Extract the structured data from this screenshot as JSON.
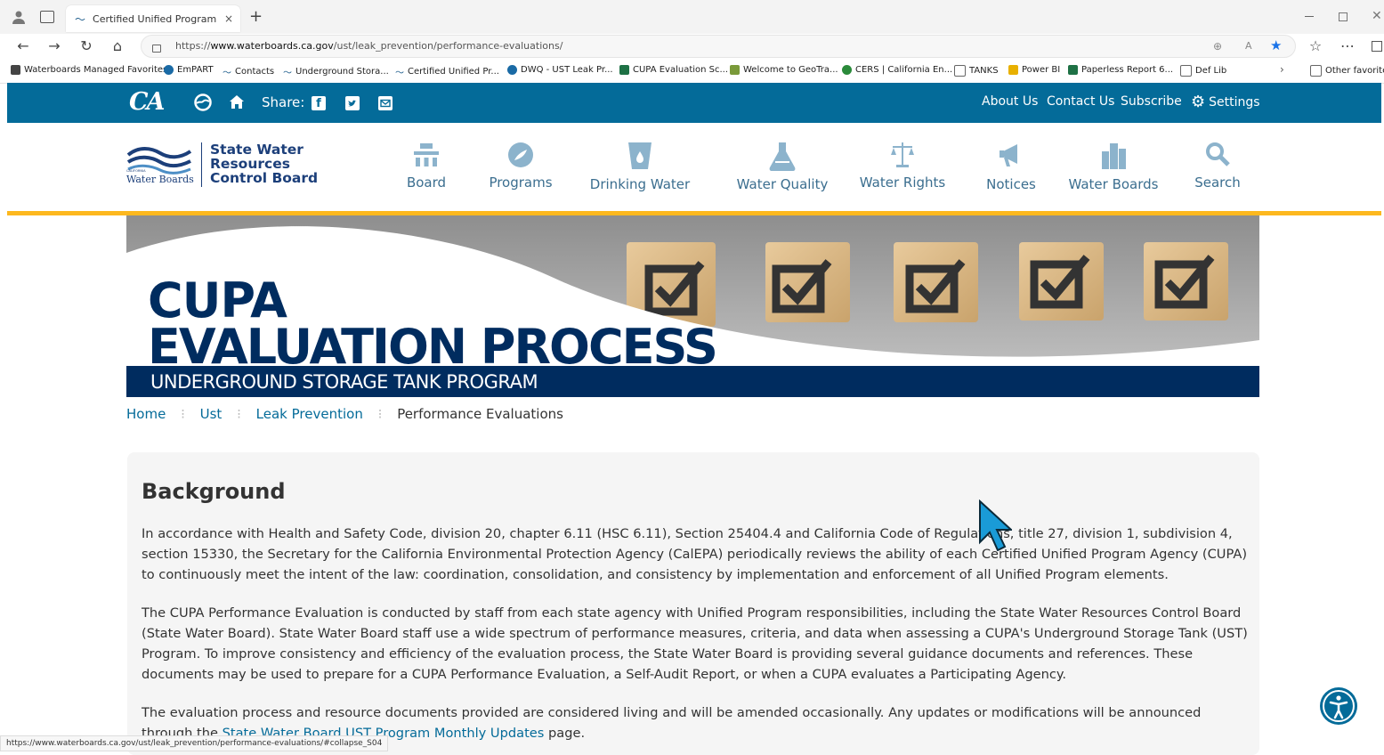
{
  "browser": {
    "tab_title": "Certified Unified Program Agency",
    "tab_close": "×",
    "new_tab": "+",
    "url_prefix": "https://",
    "url_host": "www.waterboards.ca.gov",
    "url_path": "/ust/leak_prevention/performance-evaluations/",
    "bookmarks": [
      {
        "label": "Waterboards Managed Favorites",
        "color": "#444"
      },
      {
        "label": "EmPART",
        "color": "#1a6aa5"
      },
      {
        "label": "Contacts",
        "color": "#1a5a8a"
      },
      {
        "label": "Underground Stora...",
        "color": "#1a5a8a"
      },
      {
        "label": "Certified Unified Pr...",
        "color": "#1a5a8a"
      },
      {
        "label": "DWQ - UST Leak Pr...",
        "color": "#1a6aa5"
      },
      {
        "label": "CUPA Evaluation Sc...",
        "color": "#1e7145"
      },
      {
        "label": "Welcome to GeoTra...",
        "color": "#7a9a3a"
      },
      {
        "label": "CERS | California En...",
        "color": "#2a8a3a"
      },
      {
        "label": "TANKS",
        "color": "#666"
      },
      {
        "label": "Power BI",
        "color": "#e8b000"
      },
      {
        "label": "Paperless Report 6...",
        "color": "#1e7145"
      },
      {
        "label": "Def Lib",
        "color": "#666"
      }
    ],
    "other_favorites": "Other favorites",
    "status_url": "https://www.waterboards.ca.gov/ust/leak_prevention/performance-evaluations/#collapse_S04"
  },
  "topbar": {
    "share_label": "Share:",
    "links": [
      "About Us",
      "Contact Us",
      "Subscribe"
    ],
    "settings_label": "Settings"
  },
  "logo": {
    "line1": "State Water",
    "line2": "Resources",
    "line3": "Control Board",
    "sub": "Water Boards",
    "tiny": "CALIFORNIA"
  },
  "nav": [
    {
      "label": "Board",
      "icon": "board-icon"
    },
    {
      "label": "Programs",
      "icon": "programs-icon"
    },
    {
      "label": "Drinking Water",
      "icon": "drinking-water-icon"
    },
    {
      "label": "Water Quality",
      "icon": "water-quality-icon"
    },
    {
      "label": "Water Rights",
      "icon": "water-rights-icon"
    },
    {
      "label": "Notices",
      "icon": "notices-icon"
    },
    {
      "label": "Water Boards",
      "icon": "water-boards-icon"
    },
    {
      "label": "Search",
      "icon": "search-icon"
    }
  ],
  "banner": {
    "title1": "CUPA",
    "title2": "EVALUATION PROCESS",
    "subtitle": "UNDERGROUND STORAGE TANK PROGRAM"
  },
  "breadcrumb": {
    "items": [
      "Home",
      "Ust",
      "Leak Prevention"
    ],
    "current": "Performance Evaluations"
  },
  "content": {
    "heading": "Background",
    "p1": "In accordance with Health and Safety Code, division 20, chapter 6.11 (HSC 6.11), Section 25404.4 and California Code of Regulations, title 27, division 1, subdivision 4, section 15330, the Secretary for the California Environmental Protection Agency (CalEPA) periodically reviews the ability of each Certified Unified Program Agency (CUPA) to continuously meet the intent of the law: coordination, consolidation, and consistency by implementation and enforcement of all Unified Program elements.",
    "p2": "The CUPA Performance Evaluation is conducted by staff from each state agency with Unified Program responsibilities, including the State Water Resources Control Board (State Water Board). State Water Board staff use a wide spectrum of performance measures, criteria, and data when assessing a CUPA's Underground Storage Tank (UST) Program. To improve consistency and efficiency of the evaluation process, the State Water Board is providing several guidance documents and references. These documents may be used to prepare for a CUPA Performance Evaluation, a Self-Audit Report, or when a CUPA evaluates a Participating Agency.",
    "p3_text": "The evaluation process and resource documents provided are considered living and will be amended occasionally. Any updates or modifications will be announced through the ",
    "p3_link": "State Water Board UST Program Monthly Updates",
    "p3_end": " page."
  },
  "colors": {
    "brand_blue": "#046b99",
    "gold": "#fdb81e",
    "navy": "#002c5f"
  }
}
